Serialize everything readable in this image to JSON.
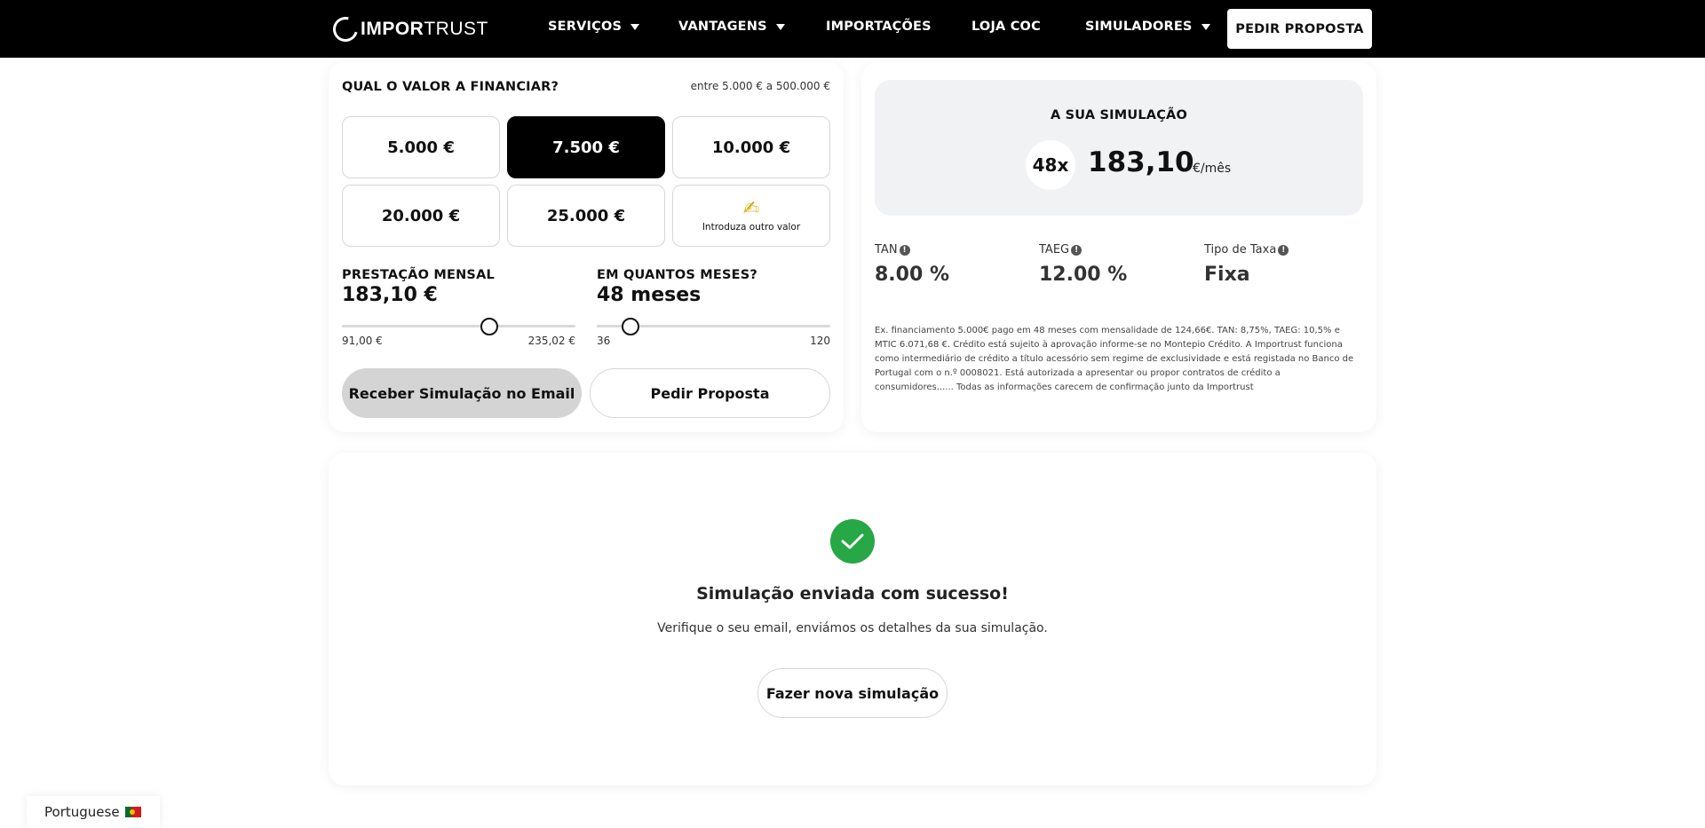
{
  "nav": {
    "logo_bold": "IMPOR",
    "logo_light": "TRUST",
    "items": [
      {
        "label": "SERVIÇOS"
      },
      {
        "label": "VANTAGENS"
      },
      {
        "label": "IMPORTAÇÕES"
      },
      {
        "label": "LOJA COC"
      },
      {
        "label": "SIMULADORES"
      }
    ],
    "cta": "PEDIR PROPOSTA"
  },
  "form": {
    "question": "QUAL O VALOR A FINANCIAR?",
    "range_note": "entre 5.000 € a 500.000 €",
    "amounts": [
      "5.000 €",
      "7.500 €",
      "10.000 €",
      "20.000 €",
      "25.000 €"
    ],
    "selected_amount": "7.500 €",
    "other_label": "Introduza outro valor",
    "other_icon": "✍",
    "monthly_label": "PRESTAÇÃO MENSAL",
    "monthly_value": "183,10 €",
    "monthly_min": "91,00 €",
    "monthly_max": "235,02 €",
    "monthly_fraction": 0.63,
    "months_label": "EM QUANTOS MESES?",
    "months_value": "48 meses",
    "months_min": "36",
    "months_max": "120",
    "months_number": 48,
    "email_button": "Receber Simulação no Email",
    "proposal_button": "Pedir Proposta"
  },
  "simulation": {
    "title": "A SUA SIMULAÇÃO",
    "months": "48x",
    "value": "183,10",
    "unit": "€/mês",
    "tan_label": "TAN",
    "tan_value": "8.00 %",
    "taeg_label": "TAEG",
    "taeg_value": "12.00 %",
    "rate_type_label": "Tipo de Taxa",
    "rate_type_value": "Fixa",
    "disclaimer": "Ex. financiamento 5.000€ pago em 48 meses com mensalidade de 124,66€. TAN: 8,75%, TAEG: 10,5% e MTIC 6.071,68 €. Crédito está sujeito à aprovação informe-se no Montepio Crédito. A Importrust funciona como intermediário de crédito a título acessório sem regime de exclusividade e está registada no Banco de Portugal com o n.º 0008021. Está autorizada a apresentar ou propor contratos de crédito a consumidores...... Todas as informações carecem de confirmação junto da Importrust"
  },
  "success": {
    "title": "Simulação enviada com sucesso!",
    "subtitle": "Verifique o seu email, enviámos os detalhes da sua simulação.",
    "button": "Fazer nova simulação"
  },
  "language": {
    "label": "Portuguese"
  },
  "colors": {
    "brand": "#000000",
    "success": "#27a745",
    "panel": "#f1f2f4"
  }
}
